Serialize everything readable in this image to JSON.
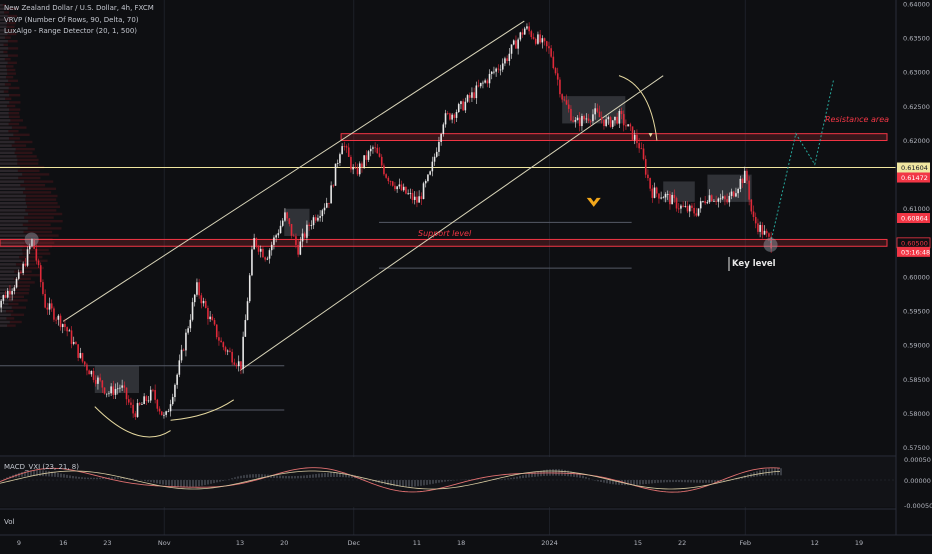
{
  "header": {
    "symbol_title": "New Zealand Dollar / U.S. Dollar, 4h, FXCM",
    "indicator_1": "VRVP (Number Of Rows, 90, Delta, 70)",
    "indicator_2": "LuxAlgo - Range Detector (20, 1, 500)"
  },
  "annotations": {
    "resistance_area": "Resistance area",
    "support_level": "Support level",
    "key_level": "Key level"
  },
  "sub_panes": {
    "macd_label": "MACD_VXI (23, 21, 8)",
    "macd_ticks": [
      "0.00050",
      "0.00000",
      "-0.00050"
    ],
    "volume_label": "Vol"
  },
  "price_axis": {
    "ticks": [
      "0.64000",
      "0.63500",
      "0.63000",
      "0.62500",
      "0.62000",
      "0.61500",
      "0.61000",
      "0.60000",
      "0.59500",
      "0.59000",
      "0.58500",
      "0.58000",
      "0.57500"
    ],
    "badges": [
      {
        "text": "0.61604",
        "color": "#f0e6a0",
        "text_color": "#131722"
      },
      {
        "text": "0.61472",
        "color": "#f23645",
        "text_color": "#ffffff"
      },
      {
        "text": "0.60864",
        "color": "#f23645",
        "text_color": "#ffffff"
      },
      {
        "text": "0.60500",
        "color": "#0e0f12",
        "text_color": "#f23645"
      },
      {
        "text": "03:16:48",
        "color": "#f23645",
        "text_color": "#ffffff"
      }
    ]
  },
  "time_axis": {
    "labels": [
      "9",
      "16",
      "23",
      "Nov",
      "13",
      "20",
      "Dec",
      "11",
      "18",
      "2024",
      "15",
      "22",
      "Feb",
      "12",
      "19"
    ]
  },
  "chart_data": {
    "type": "candlestick",
    "title": "New Zealand Dollar / U.S. Dollar, 4h, FXCM",
    "xlabel": "",
    "ylabel": "",
    "ylim": [
      0.5745,
      0.64
    ],
    "colors": {
      "up": "#e8e8e8",
      "down": "#e02a3a",
      "grid": "#1c1f26",
      "channel": "#d8d4b8"
    },
    "price_path": [
      {
        "date": "2023-10-05",
        "price": 0.5955
      },
      {
        "date": "2023-10-09",
        "price": 0.6
      },
      {
        "date": "2023-10-11",
        "price": 0.6055
      },
      {
        "date": "2023-10-13",
        "price": 0.596
      },
      {
        "date": "2023-10-16",
        "price": 0.593
      },
      {
        "date": "2023-10-19",
        "price": 0.5875
      },
      {
        "date": "2023-10-23",
        "price": 0.583
      },
      {
        "date": "2023-10-25",
        "price": 0.584
      },
      {
        "date": "2023-10-27",
        "price": 0.58
      },
      {
        "date": "2023-10-30",
        "price": 0.583
      },
      {
        "date": "2023-11-01",
        "price": 0.579
      },
      {
        "date": "2023-11-03",
        "price": 0.586
      },
      {
        "date": "2023-11-06",
        "price": 0.5985
      },
      {
        "date": "2023-11-08",
        "price": 0.594
      },
      {
        "date": "2023-11-10",
        "price": 0.59
      },
      {
        "date": "2023-11-13",
        "price": 0.587
      },
      {
        "date": "2023-11-15",
        "price": 0.6055
      },
      {
        "date": "2023-11-17",
        "price": 0.603
      },
      {
        "date": "2023-11-20",
        "price": 0.609
      },
      {
        "date": "2023-11-22",
        "price": 0.604
      },
      {
        "date": "2023-11-24",
        "price": 0.608
      },
      {
        "date": "2023-11-27",
        "price": 0.6115
      },
      {
        "date": "2023-11-29",
        "price": 0.62
      },
      {
        "date": "2023-12-01",
        "price": 0.615
      },
      {
        "date": "2023-12-04",
        "price": 0.619
      },
      {
        "date": "2023-12-06",
        "price": 0.615
      },
      {
        "date": "2023-12-08",
        "price": 0.613
      },
      {
        "date": "2023-12-11",
        "price": 0.611
      },
      {
        "date": "2023-12-13",
        "price": 0.615
      },
      {
        "date": "2023-12-15",
        "price": 0.623
      },
      {
        "date": "2023-12-18",
        "price": 0.625
      },
      {
        "date": "2023-12-21",
        "price": 0.628
      },
      {
        "date": "2023-12-25",
        "price": 0.632
      },
      {
        "date": "2023-12-28",
        "price": 0.6365
      },
      {
        "date": "2024-01-01",
        "price": 0.633
      },
      {
        "date": "2024-01-03",
        "price": 0.626
      },
      {
        "date": "2024-01-05",
        "price": 0.6225
      },
      {
        "date": "2024-01-08",
        "price": 0.624
      },
      {
        "date": "2024-01-10",
        "price": 0.6225
      },
      {
        "date": "2024-01-12",
        "price": 0.6235
      },
      {
        "date": "2024-01-15",
        "price": 0.6195
      },
      {
        "date": "2024-01-17",
        "price": 0.6125
      },
      {
        "date": "2024-01-19",
        "price": 0.612
      },
      {
        "date": "2024-01-22",
        "price": 0.61
      },
      {
        "date": "2024-01-24",
        "price": 0.6095
      },
      {
        "date": "2024-01-26",
        "price": 0.612
      },
      {
        "date": "2024-01-29",
        "price": 0.611
      },
      {
        "date": "2024-01-31",
        "price": 0.614
      },
      {
        "date": "2024-02-01",
        "price": 0.615
      },
      {
        "date": "2024-02-02",
        "price": 0.6085
      },
      {
        "date": "2024-02-05",
        "price": 0.605
      }
    ],
    "levels": [
      {
        "name": "Resistance area",
        "low": 0.62,
        "high": 0.621,
        "color": "#f23645"
      },
      {
        "name": "Support level",
        "low": 0.6045,
        "high": 0.6055,
        "color": "#f23645"
      },
      {
        "name": "0.61604",
        "value": 0.61604,
        "color": "#f0e6a0"
      }
    ],
    "projection": [
      {
        "date": "2024-02-05",
        "price": 0.605
      },
      {
        "date": "2024-02-09",
        "price": 0.621
      },
      {
        "date": "2024-02-12",
        "price": 0.6165
      },
      {
        "date": "2024-02-15",
        "price": 0.629
      }
    ]
  }
}
